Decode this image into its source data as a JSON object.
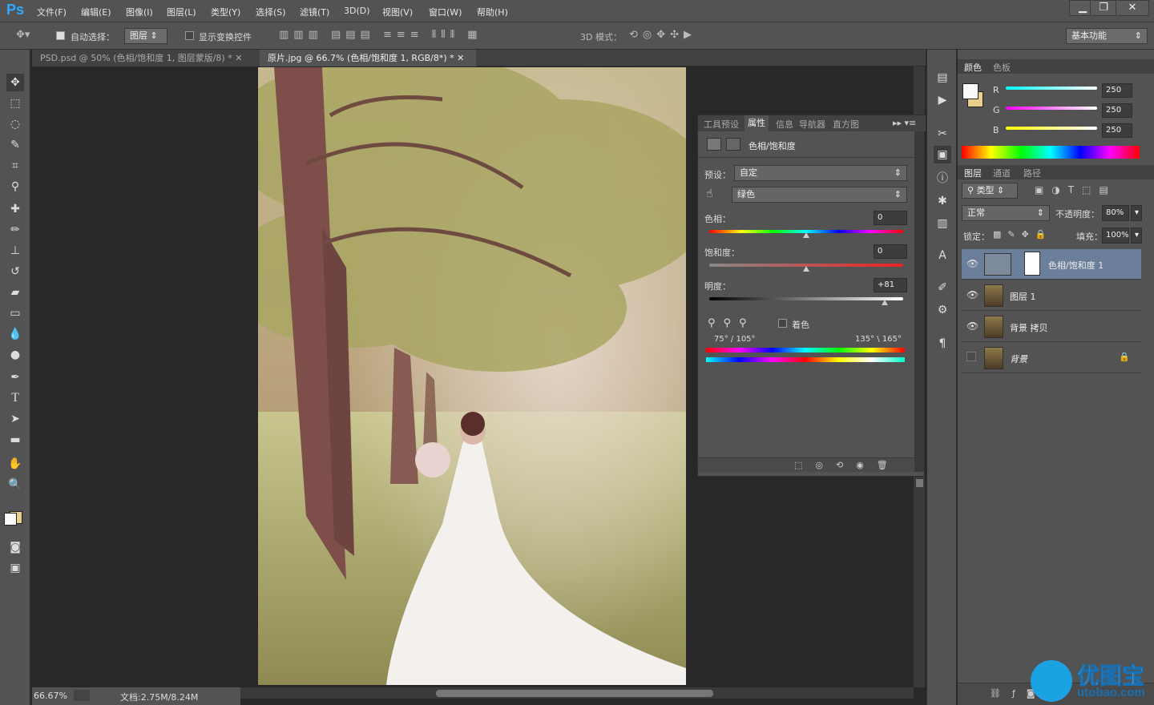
{
  "app": {
    "logo": "Ps"
  },
  "menu": [
    "文件(F)",
    "编辑(E)",
    "图像(I)",
    "图层(L)",
    "类型(Y)",
    "选择(S)",
    "滤镜(T)",
    "3D(D)",
    "视图(V)",
    "窗口(W)",
    "帮助(H)"
  ],
  "window_controls": {
    "min": "▁",
    "restore": "❐",
    "close": "✕"
  },
  "options": {
    "auto_select_label": "自动选择：",
    "auto_select_checked": true,
    "auto_select_target": "图层",
    "show_transform_label": "显示变换控件",
    "mode_3d_label": "3D 模式：",
    "workspace": "基本功能"
  },
  "tabs": [
    {
      "label": "PSD.psd @ 50% (色相/饱和度 1, 图层蒙版/8) *",
      "active": false
    },
    {
      "label": "原片.jpg @ 66.7% (色相/饱和度 1, RGB/8*) *",
      "active": true
    }
  ],
  "status": {
    "zoom": "66.67%",
    "doc": "文档:2.75M/8.24M"
  },
  "properties": {
    "tabs": [
      "工具预设",
      "属性",
      "信息",
      "导航器",
      "直方图"
    ],
    "active_tab": "属性",
    "title": "色相/饱和度",
    "preset_label": "预设：",
    "preset_value": "自定",
    "channel_value": "绿色",
    "hue_label": "色相：",
    "hue_value": "0",
    "hue_pos": 0.5,
    "sat_label": "饱和度：",
    "sat_value": "0",
    "sat_pos": 0.5,
    "light_label": "明度：",
    "light_value": "+81",
    "light_pos": 0.905,
    "colorize_label": "着色",
    "range_left": "75° / 105°",
    "range_right": "135° \\ 165°"
  },
  "color_panel": {
    "tabs": [
      "颜色",
      "色板"
    ],
    "r_label": "R",
    "g_label": "G",
    "b_label": "B",
    "r": "250",
    "g": "250",
    "b": "250",
    "fg": "#fafafa",
    "bg": "#e8d08c"
  },
  "layers_panel": {
    "tabs": [
      "图层",
      "通道",
      "路径"
    ],
    "filter_label": "类型",
    "blend": "正常",
    "opacity_label": "不透明度：",
    "opacity": "80%",
    "lock_label": "锁定：",
    "fill_label": "填充：",
    "fill": "100%",
    "layers": [
      {
        "name": "色相/饱和度 1",
        "visible": true,
        "selected": true,
        "type": "adjustment"
      },
      {
        "name": "图层 1",
        "visible": true,
        "selected": false,
        "type": "pixel"
      },
      {
        "name": "背景 拷贝",
        "visible": true,
        "selected": false,
        "type": "pixel"
      },
      {
        "name": "背景",
        "visible": false,
        "selected": false,
        "type": "background",
        "locked": true
      }
    ]
  },
  "watermark": {
    "text": "优图宝",
    "url": "utobao.com"
  }
}
